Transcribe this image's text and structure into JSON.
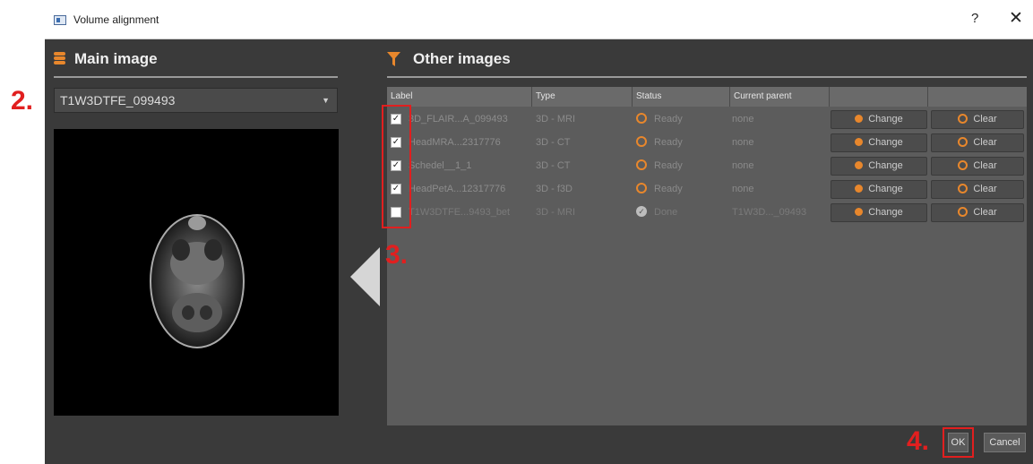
{
  "window": {
    "title": "Volume alignment",
    "help_label": "?",
    "close_label": "✕"
  },
  "main_panel": {
    "title": "Main image",
    "icon": "database-icon",
    "selected_image": "T1W3DTFE_099493",
    "dropdown_icon": "chevron-down-icon"
  },
  "other_panel": {
    "title": "Other images",
    "icon": "funnel-icon",
    "columns": [
      "Label",
      "Type",
      "Status",
      "Current parent",
      "",
      ""
    ],
    "rows": [
      {
        "checked": true,
        "label": "3D_FLAIR...A_099493",
        "type": "3D - MRI",
        "status": "Ready",
        "parent": "none",
        "change": "Change",
        "clear": "Clear"
      },
      {
        "checked": true,
        "label": "HeadMRA...2317776",
        "type": "3D - CT",
        "status": "Ready",
        "parent": "none",
        "change": "Change",
        "clear": "Clear"
      },
      {
        "checked": true,
        "label": "Schedel__1_1",
        "type": "3D - CT",
        "status": "Ready",
        "parent": "none",
        "change": "Change",
        "clear": "Clear"
      },
      {
        "checked": true,
        "label": "HeadPetA...12317776",
        "type": "3D - f3D",
        "status": "Ready",
        "parent": "none",
        "change": "Change",
        "clear": "Clear"
      },
      {
        "checked": false,
        "label": "T1W3DTFE...9493_bet",
        "type": "3D - MRI",
        "status": "Done",
        "parent": "T1W3D..._09493",
        "change": "Change",
        "clear": "Clear"
      }
    ]
  },
  "footer": {
    "ok_label": "OK",
    "cancel_label": "Cancel"
  },
  "annotations": {
    "step2": "2.",
    "step3": "3.",
    "step4": "4."
  },
  "colors": {
    "accent": "#e8872c",
    "annotation": "#e11f1f",
    "background": "#3a3a3a",
    "table_bg": "#5c5c5c"
  }
}
